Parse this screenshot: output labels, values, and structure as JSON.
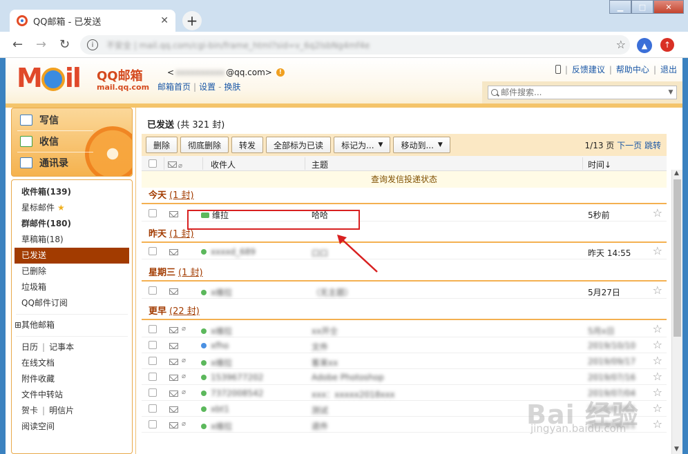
{
  "window": {
    "minimize": "▁",
    "maximize": "□",
    "close": "✕"
  },
  "tab": {
    "title": "QQ邮箱 - 已发送",
    "close": "✕",
    "new_tab": "+"
  },
  "address": {
    "back": "←",
    "forward": "→",
    "reload": "↻",
    "info": "i",
    "url": "不安全 | mail.qq.com/cgi-bin/frame_html?sid=v_6q2lsbNg4mf4e",
    "star": "☆"
  },
  "header": {
    "logo": "MOil",
    "logo_cn": "QQ邮箱",
    "logo_domain": "mail.qq.com",
    "account_prefix": "<",
    "account_blurred": "xxxxxxxxxx",
    "account_suffix": "@qq.com>",
    "links": [
      "邮箱首页",
      "设置",
      "换肤"
    ],
    "top_right": [
      "反馈建议",
      "帮助中心",
      "退出"
    ],
    "search_placeholder": "邮件搜索..."
  },
  "sidebar": {
    "actions": [
      "写信",
      "收信",
      "通讯录"
    ],
    "folders": [
      {
        "label": "收件箱(139)",
        "bold": true
      },
      {
        "label": "星标邮件",
        "star": "★"
      },
      {
        "label": "群邮件(180)",
        "bold": true
      },
      {
        "label": "草稿箱(18)"
      },
      {
        "label": "已发送",
        "active": true
      },
      {
        "label": "已删除"
      },
      {
        "label": "垃圾箱"
      },
      {
        "label": "QQ邮件订阅"
      }
    ],
    "other_mailboxes": "⊞其他邮箱",
    "tools": [
      [
        "日历",
        "记事本"
      ],
      [
        "在线文档"
      ],
      [
        "附件收藏"
      ],
      [
        "文件中转站"
      ],
      [
        "贺卡",
        "明信片"
      ],
      [
        "阅读空间"
      ]
    ]
  },
  "main": {
    "title": "已发送",
    "count": "(共 321 封)",
    "toolbar": [
      "删除",
      "彻底删除",
      "转发",
      "全部标为已读"
    ],
    "toolbar_dropdowns": [
      "标记为...",
      "移动到..."
    ],
    "pager": {
      "page": "1/13 页",
      "next": "下一页",
      "jump": "跳转"
    },
    "columns": {
      "recipient": "收件人",
      "subject": "主题",
      "time": "时间↓"
    },
    "status_link": "查询发信投递状态",
    "groups": [
      {
        "label": "今天",
        "count": "(1 封)"
      },
      {
        "label": "昨天",
        "count": "(1 封)"
      },
      {
        "label": "星期三",
        "count": "(1 封)"
      },
      {
        "label": "更早",
        "count": "(22 封)"
      }
    ],
    "rows": [
      {
        "recipient": "维拉",
        "subject": "哈哈",
        "time": "5秒前"
      },
      {
        "recipient": "xxxxd_689",
        "subject": "口口",
        "time": "昨天 14:55"
      },
      {
        "recipient": "x维拉",
        "subject": "（无主题）",
        "time": "5月27日"
      },
      {
        "recipient": "x维拉",
        "subject": "xx开仝",
        "time": "5月x日"
      },
      {
        "recipient": "xfho",
        "subject": "文件",
        "time": "2019/10/10"
      },
      {
        "recipient": "x维拉",
        "subject": "客来xx",
        "time": "2019/09/17"
      },
      {
        "recipient": "1539677202",
        "subject": "Adobe Photoshop",
        "time": "2019/07/16"
      },
      {
        "recipient": "7372008542",
        "subject": "xxx：xxxxx2018xxx",
        "time": "2019/07/04"
      },
      {
        "recipient": "xbt1",
        "subject": "测试",
        "time": "2019/07/01"
      },
      {
        "recipient": "x维拉",
        "subject": "退件",
        "time": "2019/06/21"
      }
    ],
    "row_star": "☆"
  },
  "watermark": {
    "main": "Bai 经验",
    "sub": "jingyan.baidu.com"
  },
  "colors": {
    "accent": "#a23b00",
    "toolbar_bg": "#fbe8c4",
    "highlight": "#d82020"
  }
}
